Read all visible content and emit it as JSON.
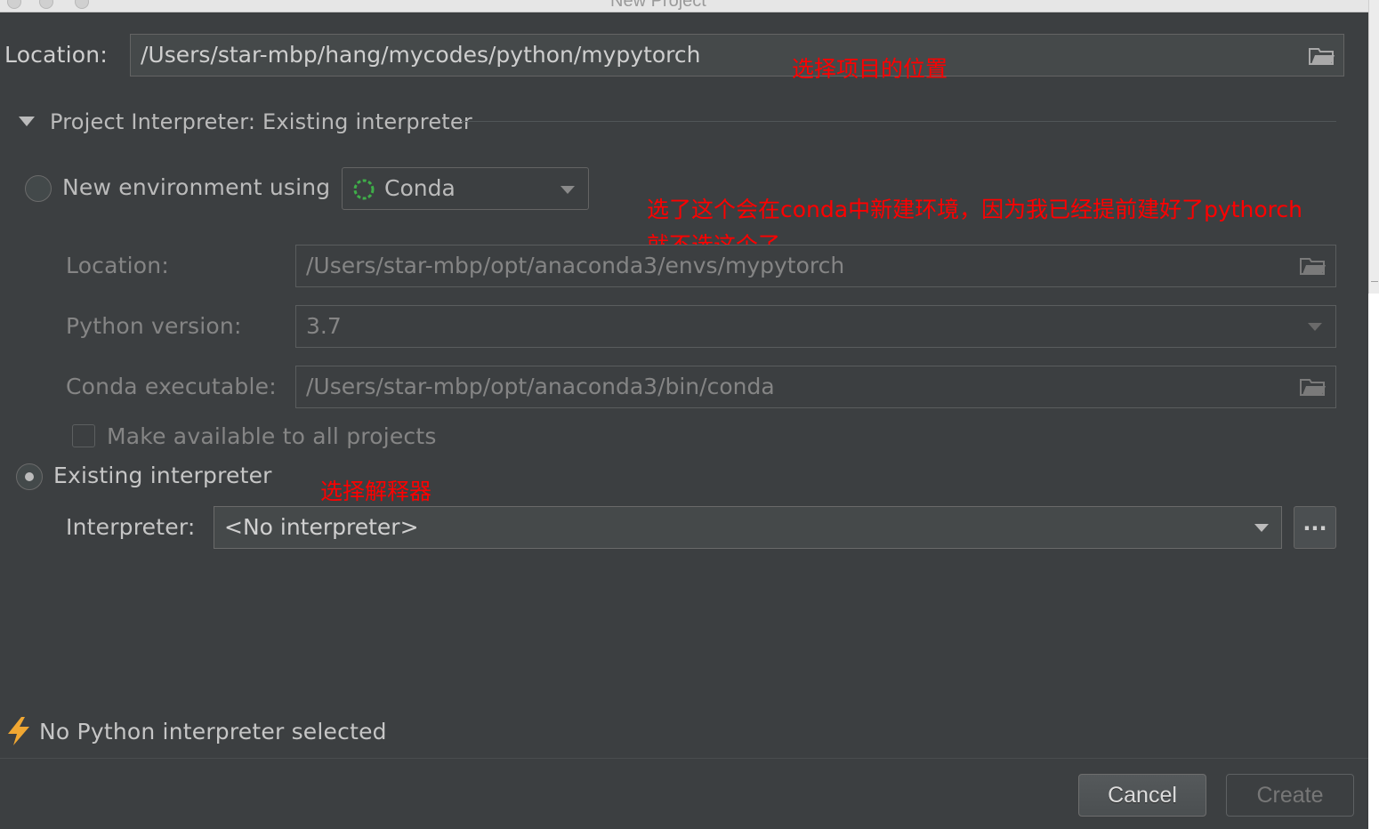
{
  "window": {
    "title": "New Project"
  },
  "project": {
    "location_label": "Location:",
    "location_value": "/Users/star-mbp/hang/mycodes/python/mypytorch"
  },
  "interpreter_section": {
    "title": "Project Interpreter: Existing interpreter"
  },
  "new_env": {
    "radio_label": "New environment using",
    "env_tool": "Conda",
    "location_label": "Location:",
    "location_value": "/Users/star-mbp/opt/anaconda3/envs/mypytorch",
    "python_version_label": "Python version:",
    "python_version_value": "3.7",
    "conda_exec_label": "Conda executable:",
    "conda_exec_value": "/Users/star-mbp/opt/anaconda3/bin/conda",
    "make_available_label": "Make available to all projects"
  },
  "existing": {
    "radio_label": "Existing interpreter",
    "interpreter_label": "Interpreter:",
    "interpreter_value": "<No interpreter>",
    "browse_label": "..."
  },
  "status": {
    "message": "No Python interpreter selected"
  },
  "buttons": {
    "cancel": "Cancel",
    "create": "Create"
  },
  "annotations": {
    "location_note": "选择项目的位置",
    "conda_note_line1": "选了这个会在conda中新建环境，因为我已经提前建好了pythorch",
    "conda_note_line2": "就不选这个了",
    "interpreter_note": "选择解释器"
  },
  "colors": {
    "background": "#3c3f41",
    "field": "#45494a",
    "text": "#bbbbbb",
    "disabled_text": "#858585",
    "annotation": "#ff0000",
    "warning_icon": "#f0a732",
    "conda_icon": "#3fae49"
  }
}
